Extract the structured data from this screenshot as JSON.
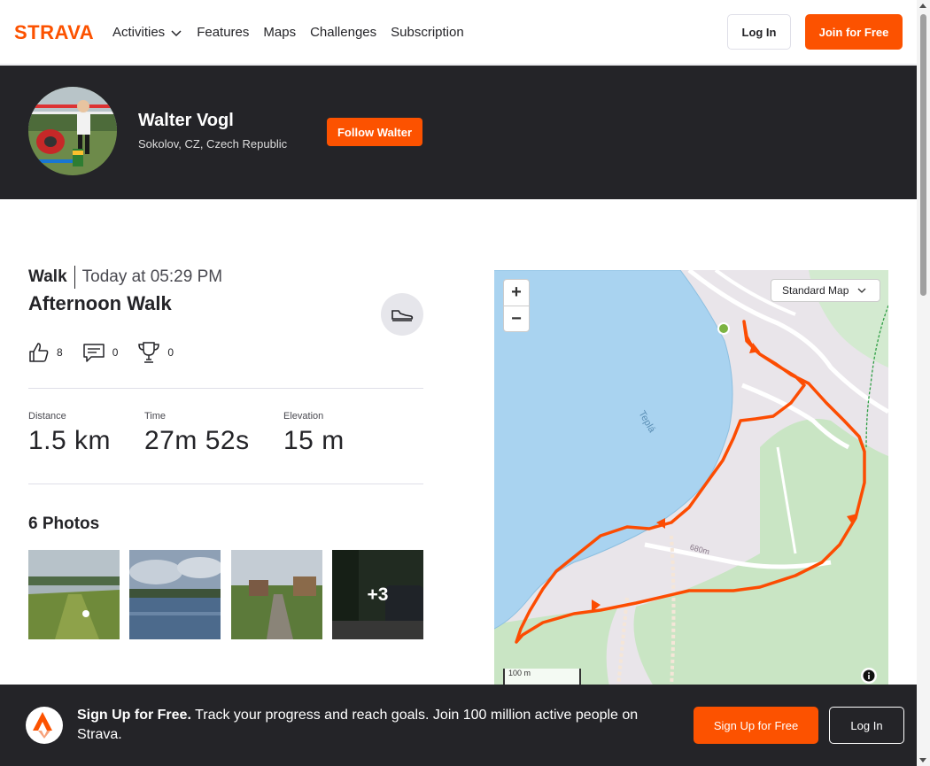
{
  "nav": {
    "logo_text": "STRAVA",
    "links": [
      "Activities",
      "Features",
      "Maps",
      "Challenges",
      "Subscription"
    ],
    "login_label": "Log In",
    "join_label": "Join for Free"
  },
  "athlete": {
    "name": "Walter Vogl",
    "location": "Sokolov, CZ, Czech Republic",
    "follow_label": "Follow Walter"
  },
  "activity": {
    "type": "Walk",
    "time": "Today at 05:29 PM",
    "name": "Afternoon Walk",
    "kudos": "8",
    "comments": "0",
    "achievements": "0",
    "stats": [
      {
        "label": "Distance",
        "value": "1.5 km"
      },
      {
        "label": "Time",
        "value": "27m 52s"
      },
      {
        "label": "Elevation",
        "value": "15 m"
      }
    ],
    "photos_title": "6 Photos",
    "photos_more": "+3"
  },
  "map": {
    "zoom_in": "+",
    "zoom_out": "−",
    "style_select": "Standard Map",
    "scale_label": "100 m",
    "water_label": "Teplá",
    "road_label": "680m",
    "route_color": "#fc4c02",
    "start_color": "#7cb342"
  },
  "banner": {
    "headline": "Sign Up for Free.",
    "text": "Track your progress and reach goals. Join 100 million active people on Strava.",
    "signup_label": "Sign Up for Free",
    "login_label": "Log In"
  },
  "colors": {
    "brand": "#fc5200",
    "dark": "#242428"
  }
}
